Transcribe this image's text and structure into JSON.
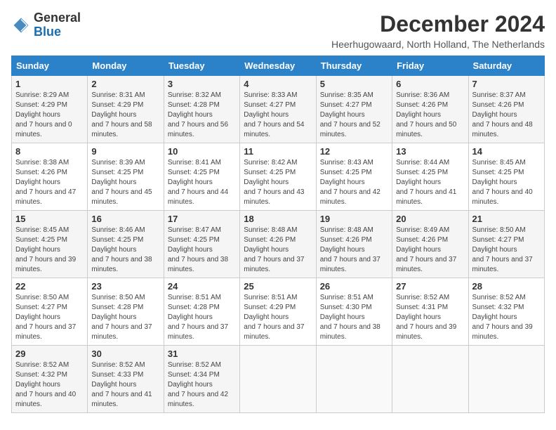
{
  "logo": {
    "general": "General",
    "blue": "Blue"
  },
  "title": "December 2024",
  "subtitle": "Heerhugowaard, North Holland, The Netherlands",
  "days_of_week": [
    "Sunday",
    "Monday",
    "Tuesday",
    "Wednesday",
    "Thursday",
    "Friday",
    "Saturday"
  ],
  "weeks": [
    [
      {
        "day": 1,
        "sunrise": "8:29 AM",
        "sunset": "4:29 PM",
        "daylight": "7 hours and 0 minutes."
      },
      {
        "day": 2,
        "sunrise": "8:31 AM",
        "sunset": "4:29 PM",
        "daylight": "7 hours and 58 minutes."
      },
      {
        "day": 3,
        "sunrise": "8:32 AM",
        "sunset": "4:28 PM",
        "daylight": "7 hours and 56 minutes."
      },
      {
        "day": 4,
        "sunrise": "8:33 AM",
        "sunset": "4:27 PM",
        "daylight": "7 hours and 54 minutes."
      },
      {
        "day": 5,
        "sunrise": "8:35 AM",
        "sunset": "4:27 PM",
        "daylight": "7 hours and 52 minutes."
      },
      {
        "day": 6,
        "sunrise": "8:36 AM",
        "sunset": "4:26 PM",
        "daylight": "7 hours and 50 minutes."
      },
      {
        "day": 7,
        "sunrise": "8:37 AM",
        "sunset": "4:26 PM",
        "daylight": "7 hours and 48 minutes."
      }
    ],
    [
      {
        "day": 8,
        "sunrise": "8:38 AM",
        "sunset": "4:26 PM",
        "daylight": "7 hours and 47 minutes."
      },
      {
        "day": 9,
        "sunrise": "8:39 AM",
        "sunset": "4:25 PM",
        "daylight": "7 hours and 45 minutes."
      },
      {
        "day": 10,
        "sunrise": "8:41 AM",
        "sunset": "4:25 PM",
        "daylight": "7 hours and 44 minutes."
      },
      {
        "day": 11,
        "sunrise": "8:42 AM",
        "sunset": "4:25 PM",
        "daylight": "7 hours and 43 minutes."
      },
      {
        "day": 12,
        "sunrise": "8:43 AM",
        "sunset": "4:25 PM",
        "daylight": "7 hours and 42 minutes."
      },
      {
        "day": 13,
        "sunrise": "8:44 AM",
        "sunset": "4:25 PM",
        "daylight": "7 hours and 41 minutes."
      },
      {
        "day": 14,
        "sunrise": "8:45 AM",
        "sunset": "4:25 PM",
        "daylight": "7 hours and 40 minutes."
      }
    ],
    [
      {
        "day": 15,
        "sunrise": "8:45 AM",
        "sunset": "4:25 PM",
        "daylight": "7 hours and 39 minutes."
      },
      {
        "day": 16,
        "sunrise": "8:46 AM",
        "sunset": "4:25 PM",
        "daylight": "7 hours and 38 minutes."
      },
      {
        "day": 17,
        "sunrise": "8:47 AM",
        "sunset": "4:25 PM",
        "daylight": "7 hours and 38 minutes."
      },
      {
        "day": 18,
        "sunrise": "8:48 AM",
        "sunset": "4:26 PM",
        "daylight": "7 hours and 37 minutes."
      },
      {
        "day": 19,
        "sunrise": "8:48 AM",
        "sunset": "4:26 PM",
        "daylight": "7 hours and 37 minutes."
      },
      {
        "day": 20,
        "sunrise": "8:49 AM",
        "sunset": "4:26 PM",
        "daylight": "7 hours and 37 minutes."
      },
      {
        "day": 21,
        "sunrise": "8:50 AM",
        "sunset": "4:27 PM",
        "daylight": "7 hours and 37 minutes."
      }
    ],
    [
      {
        "day": 22,
        "sunrise": "8:50 AM",
        "sunset": "4:27 PM",
        "daylight": "7 hours and 37 minutes."
      },
      {
        "day": 23,
        "sunrise": "8:50 AM",
        "sunset": "4:28 PM",
        "daylight": "7 hours and 37 minutes."
      },
      {
        "day": 24,
        "sunrise": "8:51 AM",
        "sunset": "4:28 PM",
        "daylight": "7 hours and 37 minutes."
      },
      {
        "day": 25,
        "sunrise": "8:51 AM",
        "sunset": "4:29 PM",
        "daylight": "7 hours and 37 minutes."
      },
      {
        "day": 26,
        "sunrise": "8:51 AM",
        "sunset": "4:30 PM",
        "daylight": "7 hours and 38 minutes."
      },
      {
        "day": 27,
        "sunrise": "8:52 AM",
        "sunset": "4:31 PM",
        "daylight": "7 hours and 39 minutes."
      },
      {
        "day": 28,
        "sunrise": "8:52 AM",
        "sunset": "4:32 PM",
        "daylight": "7 hours and 39 minutes."
      }
    ],
    [
      {
        "day": 29,
        "sunrise": "8:52 AM",
        "sunset": "4:32 PM",
        "daylight": "7 hours and 40 minutes."
      },
      {
        "day": 30,
        "sunrise": "8:52 AM",
        "sunset": "4:33 PM",
        "daylight": "7 hours and 41 minutes."
      },
      {
        "day": 31,
        "sunrise": "8:52 AM",
        "sunset": "4:34 PM",
        "daylight": "7 hours and 42 minutes."
      },
      null,
      null,
      null,
      null
    ]
  ]
}
